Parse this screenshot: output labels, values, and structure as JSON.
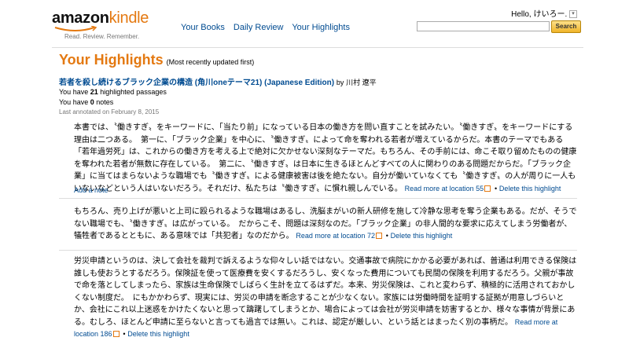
{
  "header": {
    "logo_amazon": "amazon",
    "logo_kindle": "kindle",
    "logo_tagline": "Read. Review. Remember.",
    "nav": [
      "Your Books",
      "Daily Review",
      "Your Highlights"
    ],
    "greeting": "Hello, けいろー.",
    "search_value": "",
    "search_button": "Search"
  },
  "page": {
    "title": "Your Highlights",
    "subtitle": "(Most recently updated first)"
  },
  "book": {
    "title": "若者を殺し続けるブラック企業の構造 (角川oneテーマ21) (Japanese Edition)",
    "by": "by",
    "author": "川村 遼平",
    "highlights_prefix": "You have",
    "highlights_count": "21",
    "highlights_suffix": "highlighted passages",
    "notes_prefix": "You have",
    "notes_count": "0",
    "notes_suffix": "notes",
    "last_annotated": "Last annotated on February 8, 2015"
  },
  "highlights": [
    {
      "text": "本書では、〝働きすぎ〟をキーワードに、「当たり前」になっている日本の働き方を問い直すことを試みたい。〝働きすぎ〟をキーワードにする理由は二つある。　第一に、「ブラック企業」を中心に、〝働きすぎ〟によって命を奪われる若者が増えているからだ。本書のテーマでもある「若年過労死」は、これからの働き方を考える上で絶対に欠かせない深刻なテーマだ。もちろん、その手前には、命こそ取り留めたものの健康を奪われた若者が無数に存在している。　第二に、〝働きすぎ〟は日本に生きるほとんどすべての人に関わりのある問題だからだ。「ブラック企業」に当てはまらないような職場でも〝働きすぎ〟による健康被害は後を絶たない。自分が働いていなくても〝働きすぎ〟の人が周りに一人もいないなどという人はいないだろう。それだけ、私たちは〝働きすぎ〟に慣れ親しんでいる。",
      "read_more": "Read more at location 55",
      "separator": "•",
      "delete": "Delete this highlight",
      "add_note": "Add a note"
    },
    {
      "text": "もちろん、売り上げが悪いと上司に殴られるような職場はあるし、洗脳まがいの新人研修を施して冷静な思考を奪う企業もある。だが、そうでない職場でも、〝働きすぎ〟は広がっている。　だからこそ、問題は深刻なのだ。「ブラック企業」の非人間的な要求に応えてしまう労働者が、犠牲者であるとともに、ある意味では「共犯者」なのだから。",
      "read_more": "Read more at location 72",
      "separator": "•",
      "delete": "Delete this highlight"
    },
    {
      "text": "労災申請というのは、決して会社を裁判で訴えるような仰々しい話ではない。交通事故で病院にかかる必要があれば、普通は利用できる保険は誰しも使おうとするだろう。保険証を使って医療費を安くするだろうし、安くなった費用についても民間の保険を利用するだろう。父親が事故で命を落としてしまったら、家族は生命保険でしばらく生計を立てるはずだ。本来、労災保険は、これと変わらず、積極的に活用されておかしくない制度だ。　にもかかわらず、現実には、労災の申請を断念することが少なくない。家族には労働時間を証明する証拠が用意しづらいとか、会社にこれ以上迷惑をかけたくないと思って躊躇してしまうとか、場合によっては会社が労災申請を妨害するとか、様々な事情が背景にある。むしろ、ほとんど申請に至らないと言っても過言では無い。これは、認定が厳しい、という話とはまったく別の事柄だ。",
      "read_more": "Read more at location 186",
      "separator": "•",
      "delete": "Delete this highlight"
    }
  ],
  "colors": {
    "accent": "#e47911",
    "link": "#004b91"
  }
}
